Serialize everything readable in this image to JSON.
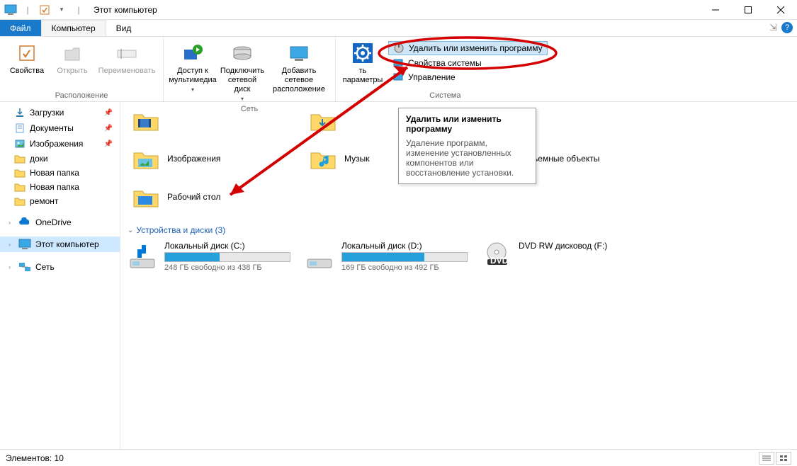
{
  "window": {
    "title": "Этот компьютер"
  },
  "menubar": {
    "file": "Файл",
    "computer": "Компьютер",
    "view": "Вид"
  },
  "ribbon": {
    "group_location": "Расположение",
    "group_network": "Сеть",
    "group_system": "Система",
    "properties": "Свойства",
    "open": "Открыть",
    "rename": "Переименовать",
    "media_access": "Доступ к\nмультимедиа",
    "map_drive": "Подключить\nсетевой диск",
    "add_network": "Добавить сетевое\nрасположение",
    "open_settings_suffix": "ть\nпараметры",
    "uninstall": "Удалить или изменить программу",
    "sys_properties": "Свойства системы",
    "manage": "Управление"
  },
  "sidebar": {
    "downloads": "Загрузки",
    "documents": "Документы",
    "pictures": "Изображения",
    "doki": "доки",
    "new_folder1": "Новая папка",
    "new_folder2": "Новая папка",
    "remont": "ремонт",
    "onedrive": "OneDrive",
    "this_pc": "Этот компьютер",
    "network": "Сеть"
  },
  "folders": {
    "pictures": "Изображения",
    "music": "Музык",
    "volumetric": "Объемные объекты",
    "desktop": "Рабочий стол"
  },
  "section": {
    "devices_drives": "Устройства и диски (3)"
  },
  "drives": [
    {
      "name": "Локальный диск (C:)",
      "free": "248 ГБ свободно из 438 ГБ",
      "fill_pct": 44
    },
    {
      "name": "Локальный диск (D:)",
      "free": "169 ГБ свободно из 492 ГБ",
      "fill_pct": 66
    },
    {
      "name": "DVD RW дисковод (F:)",
      "free": "",
      "fill_pct": 0
    }
  ],
  "tooltip": {
    "title": "Удалить или изменить программу",
    "body": "Удаление программ, изменение установленных компонентов или восстановление установки."
  },
  "statusbar": {
    "count": "Элементов: 10"
  }
}
